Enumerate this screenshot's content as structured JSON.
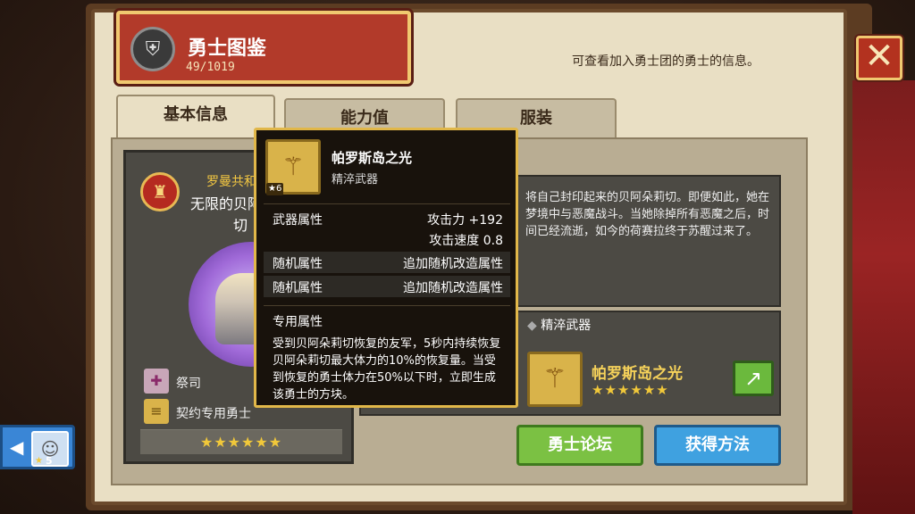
{
  "header": {
    "title": "勇士图鉴",
    "count": "49/1019",
    "note": "可查看加入勇士团的勇士的信息。"
  },
  "close_label": "✕",
  "tabs": [
    {
      "label": "基本信息"
    },
    {
      "label": "能力值"
    },
    {
      "label": "服装"
    }
  ],
  "hero": {
    "faction": "罗曼共和",
    "name_line1": "无限的贝阿",
    "name_line2": "切",
    "role": "祭司",
    "contract": "契约专用勇士",
    "stars": "★★★★★★"
  },
  "story": {
    "text": "将自己封印起来的贝阿朵莉切。即便如此，她在梦境中与恶魔战斗。当她除掉所有恶魔之后，时间已经流逝，如今的荷赛拉终于苏醒过来了。"
  },
  "weapon_panel": {
    "header": "精淬武器",
    "name": "帕罗斯岛之光",
    "stars": "★★★★★★"
  },
  "buttons": {
    "forum": "勇士论坛",
    "obtain": "获得方法"
  },
  "side_party": {
    "stars": "5"
  },
  "tooltip": {
    "name": "帕罗斯岛之光",
    "type": "精淬武器",
    "level_badge": "6",
    "weapon_attr_label": "武器属性",
    "attack": "攻击力 +192",
    "attack_speed": "攻击速度 0.8",
    "random_label_1": "随机属性",
    "random_value_1": "追加随机改造属性",
    "random_label_2": "随机属性",
    "random_value_2": "追加随机改造属性",
    "exclusive_label": "专用属性",
    "exclusive_desc": "受到贝阿朵莉切恢复的友军，5秒内持续恢复贝阿朵莉切最大体力的10%的恢复量。当受到恢复的勇士体力在50%以下时，立即生成该勇士的方块。"
  }
}
